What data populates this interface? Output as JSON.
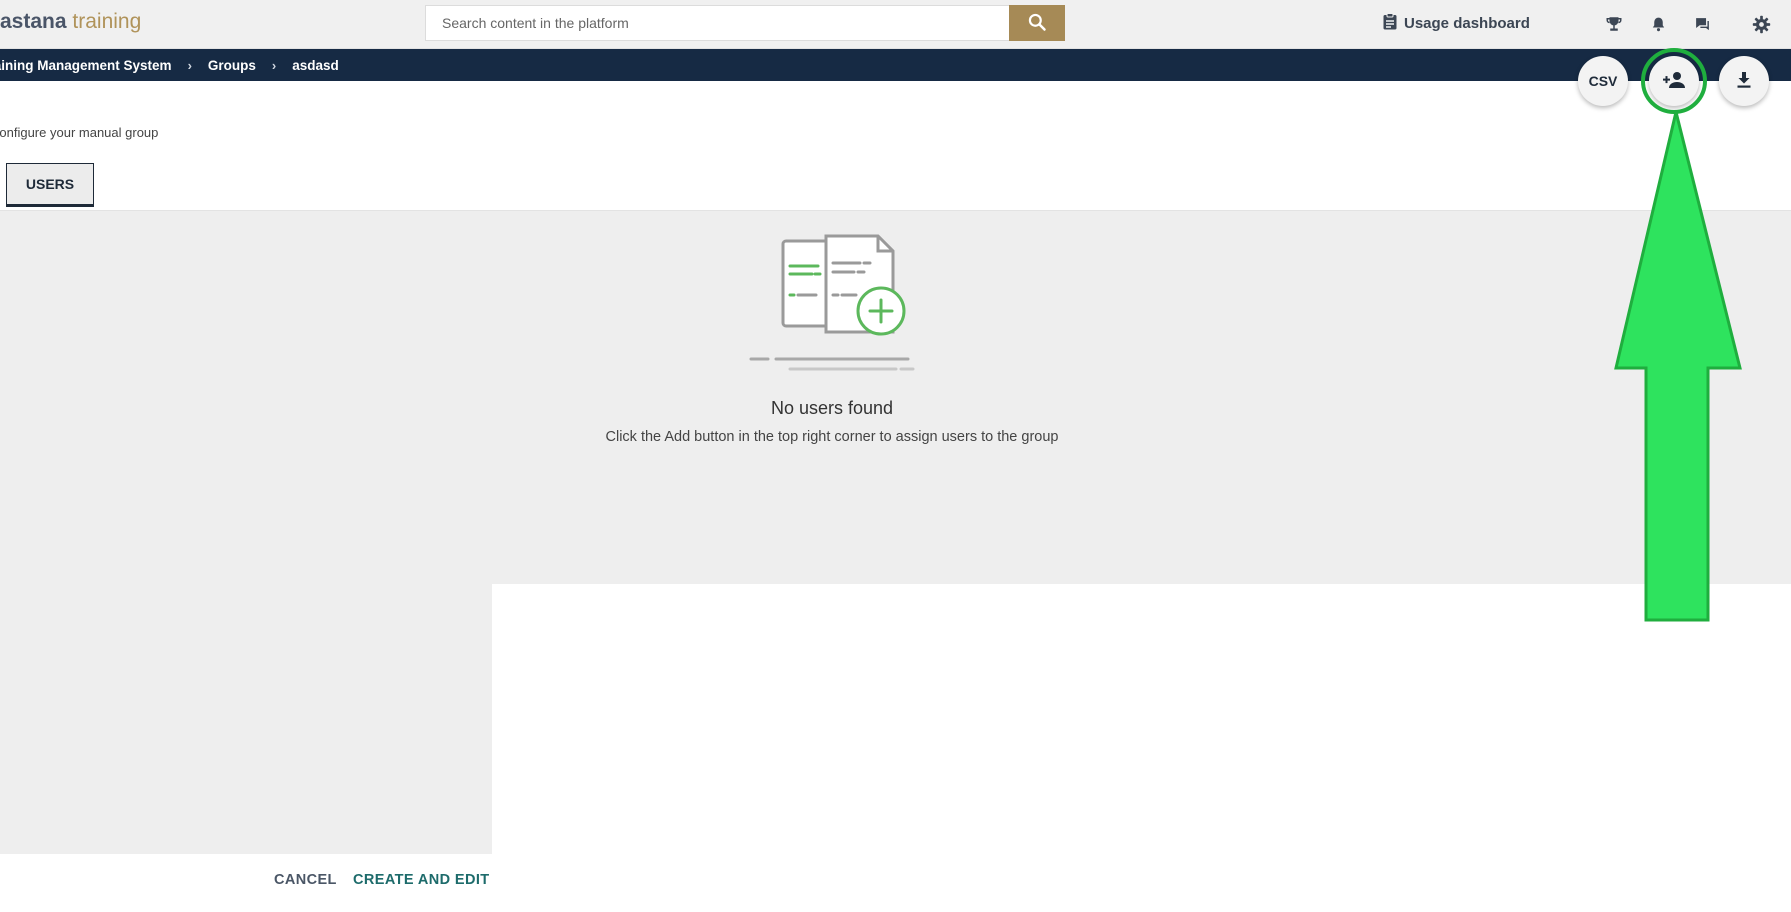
{
  "header": {
    "logo": {
      "part1": "astana",
      "part2": "training"
    },
    "search": {
      "placeholder": "Search content in the platform"
    },
    "usage_dashboard_label": "Usage dashboard",
    "icons": [
      "search-icon",
      "clipboard-icon",
      "trophy-icon",
      "bell-icon",
      "chat-icon",
      "gear-icon"
    ]
  },
  "breadcrumb": {
    "items": [
      "Training Management System",
      "Groups",
      "asdasd"
    ],
    "separator": "›"
  },
  "actions": {
    "csv_label": "CSV",
    "icons": [
      "add-user-icon",
      "download-icon"
    ]
  },
  "page": {
    "subtitle": "Configure your manual group",
    "tabs": [
      {
        "label": "USERS",
        "active": true
      }
    ]
  },
  "empty_state": {
    "title": "No users found",
    "message": "Click the Add button in the top right corner to assign users to the group"
  },
  "footer": {
    "cancel_label": "CANCEL",
    "create_label": "CREATE AND EDIT"
  },
  "colors": {
    "brand_gold": "#a68a56",
    "navy": "#162a44",
    "accent_green": "#5cb85c",
    "annotation_green": "#2ee35e",
    "teal": "#1d6b6b"
  }
}
